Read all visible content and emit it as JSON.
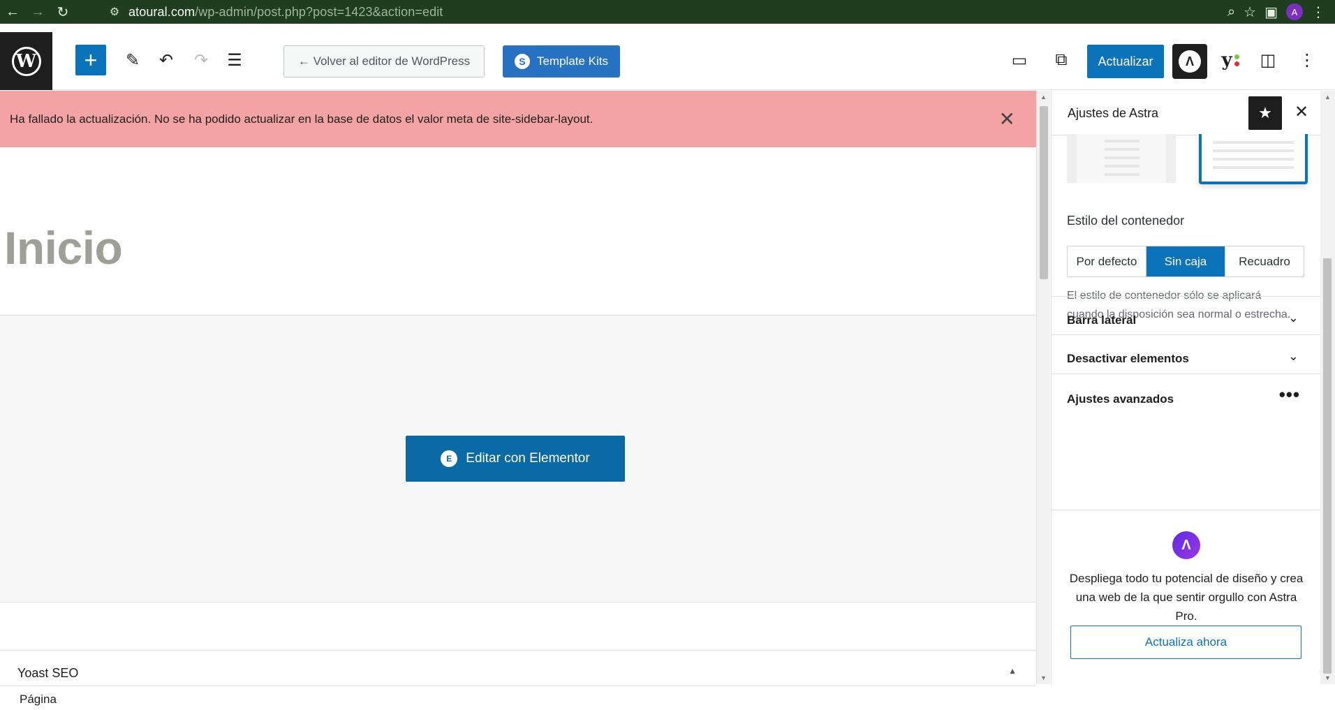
{
  "browser": {
    "url_host": "atoural.com",
    "url_path": "/wp-admin/post.php?post=1423&action=edit",
    "profile_initial": "A"
  },
  "toolbar": {
    "back_label": "← Volver al editor de WordPress",
    "template_kits_label": "Template Kits",
    "update_label": "Actualizar"
  },
  "notice": {
    "message": "Ha fallado la actualización. No se ha podido actualizar en la base de datos el valor meta de site-sidebar-layout."
  },
  "canvas": {
    "page_title": "Inicio",
    "elementor_button": "Editar con Elementor"
  },
  "metabox": {
    "title": "Yoast SEO",
    "tab_label": "Página"
  },
  "sidebar": {
    "title": "Ajustes de Astra",
    "container_label": "Estilo del contenedor",
    "container_options": [
      "Por defecto",
      "Sin caja",
      "Recuadro"
    ],
    "container_selected": "Sin caja",
    "container_help": "El estilo de contenedor sólo se aplicará cuando la disposición sea normal o estrecha.",
    "accordions": [
      "Barra lateral",
      "Desactivar elementos",
      "Ajustes avanzados"
    ],
    "promo_text": "Despliega todo tu potencial de diseño y crea una web de la que sentir orgullo con Astra Pro.",
    "promo_cta": "Actualiza ahora"
  },
  "colors": {
    "wp_blue": "#0a73ba",
    "notice_error_bg": "#f4a3a5",
    "browser_bar": "#1f3d1f"
  }
}
